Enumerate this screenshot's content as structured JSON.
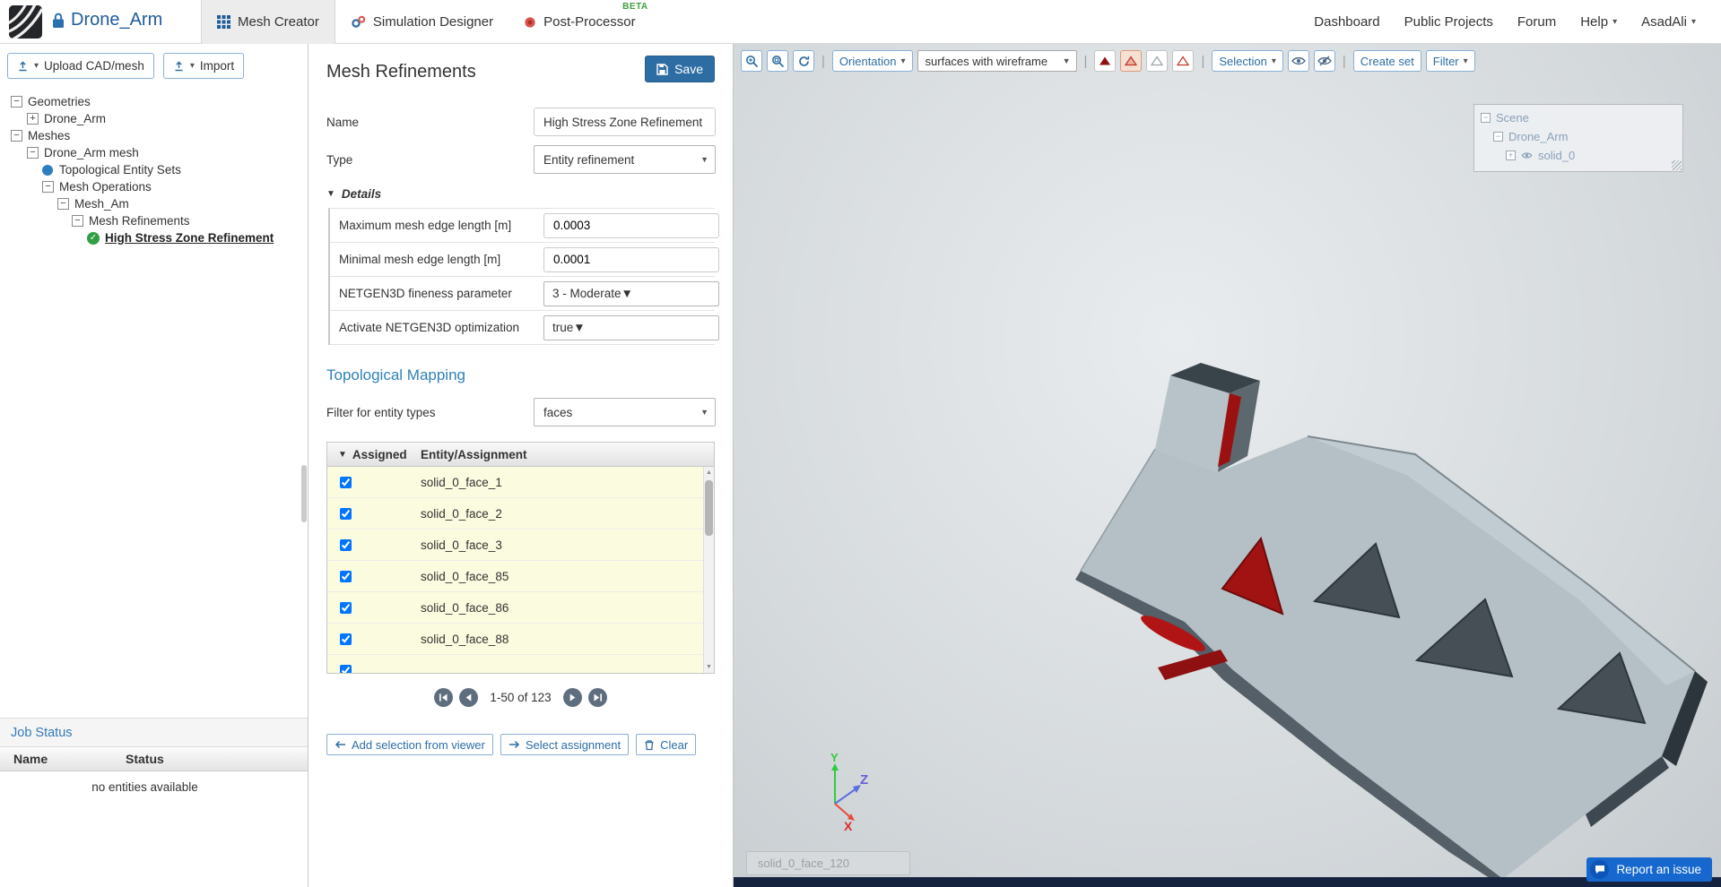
{
  "colors": {
    "accent_blue": "#2e6da4",
    "title_blue": "#1f5c99",
    "heading_blue": "#2e81b8",
    "highlight_red": "#a11212",
    "report_blue": "#1668cf",
    "row_yellow": "#fbfbdf"
  },
  "navbar": {
    "title": "Drone_Arm",
    "tabs": [
      {
        "label": "Mesh Creator"
      },
      {
        "label": "Simulation Designer"
      },
      {
        "label": "Post-Processor",
        "beta": "BETA"
      }
    ],
    "links": {
      "dashboard": "Dashboard",
      "public_projects": "Public Projects",
      "forum": "Forum",
      "help": "Help",
      "user": "AsadAli"
    }
  },
  "sidebar": {
    "upload_button": "Upload CAD/mesh",
    "import_button": "Import",
    "tree": [
      {
        "label": "Geometries"
      },
      {
        "label": "Drone_Arm"
      },
      {
        "label": "Meshes"
      },
      {
        "label": "Drone_Arm mesh"
      },
      {
        "label": "Topological Entity Sets"
      },
      {
        "label": "Mesh Operations"
      },
      {
        "label": "Mesh_Am"
      },
      {
        "label": "Mesh Refinements"
      },
      {
        "label": "High Stress Zone Refinement"
      }
    ],
    "job_status": {
      "title": "Job Status",
      "col_name": "Name",
      "col_status": "Status",
      "empty": "no entities available"
    }
  },
  "panel": {
    "title": "Mesh Refinements",
    "save": "Save",
    "name_label": "Name",
    "name_value": "High Stress Zone Refinement",
    "type_label": "Type",
    "type_value": "Entity refinement",
    "details_label": "Details",
    "fields": [
      {
        "label": "Maximum mesh edge length [m]",
        "value": "0.0003"
      },
      {
        "label": "Minimal mesh edge length [m]",
        "value": "0.0001"
      },
      {
        "label": "NETGEN3D fineness parameter",
        "value": "3 - Moderate"
      },
      {
        "label": "Activate NETGEN3D optimization",
        "value": "true"
      }
    ],
    "topo_heading": "Topological Mapping",
    "filter_label": "Filter for entity types",
    "filter_value": "faces",
    "table": {
      "col_assigned": "Assigned",
      "col_entity": "Entity/Assignment",
      "rows": [
        "solid_0_face_1",
        "solid_0_face_2",
        "solid_0_face_3",
        "solid_0_face_85",
        "solid_0_face_86",
        "solid_0_face_88",
        ""
      ]
    },
    "pagination": "1-50 of 123",
    "actions": {
      "add_selection": "Add selection from viewer",
      "select_assignment": "Select assignment",
      "clear": "Clear"
    }
  },
  "viewer": {
    "orientation": "Orientation",
    "render_mode": "surfaces with wireframe",
    "selection": "Selection",
    "create_set": "Create set",
    "filter": "Filter",
    "scene_tree": {
      "root": "Scene",
      "child": "Drone_Arm",
      "leaf": "solid_0"
    },
    "axes": {
      "x": "X",
      "y": "Y",
      "z": "Z"
    },
    "tooltip": "solid_0_face_120",
    "report_issue": "Report an issue"
  }
}
